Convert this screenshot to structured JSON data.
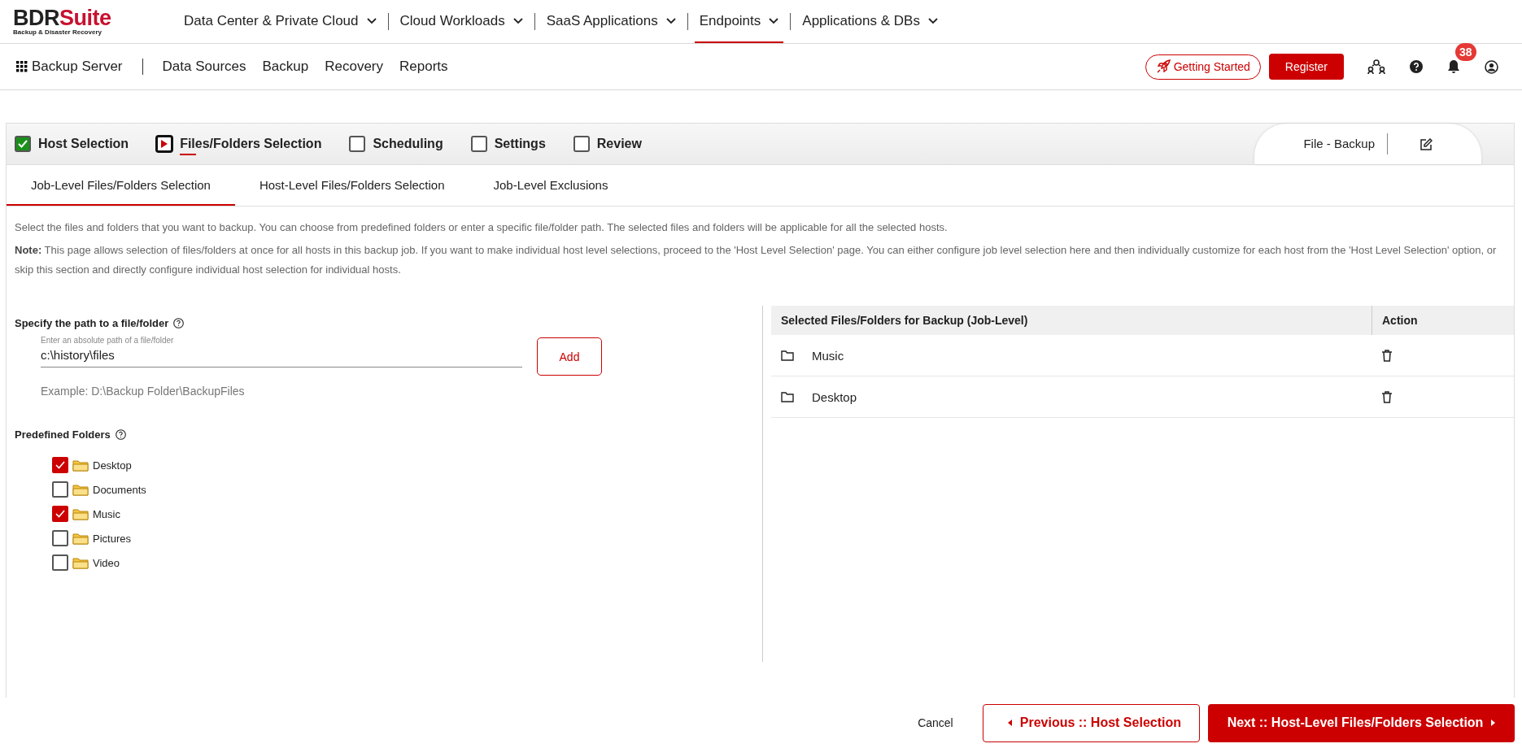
{
  "brand": {
    "prefix": "BDR",
    "suffix": "Suite",
    "tagline": "Backup & Disaster Recovery"
  },
  "top_menu": [
    {
      "label": "Data Center & Private Cloud",
      "selected": false
    },
    {
      "label": "Cloud Workloads",
      "selected": false
    },
    {
      "label": "SaaS Applications",
      "selected": false
    },
    {
      "label": "Endpoints",
      "selected": true
    },
    {
      "label": "Applications & DBs",
      "selected": false
    }
  ],
  "sub_nav": {
    "app_name": "Backup Server",
    "items": [
      "Data Sources",
      "Backup",
      "Recovery",
      "Reports"
    ],
    "getting_started": "Getting Started",
    "register": "Register",
    "notification_count": "38"
  },
  "wizard": {
    "steps": [
      {
        "label": "Host Selection",
        "done": true,
        "selected": false
      },
      {
        "label": "Files/Folders Selection",
        "done": false,
        "selected": true
      },
      {
        "label": "Scheduling",
        "done": false,
        "selected": false
      },
      {
        "label": "Settings",
        "done": false,
        "selected": false
      },
      {
        "label": "Review",
        "done": false,
        "selected": false
      }
    ],
    "job_name": "File - Backup"
  },
  "tabs": [
    {
      "label": "Job-Level Files/Folders Selection",
      "selected": true
    },
    {
      "label": "Host-Level Files/Folders Selection",
      "selected": false
    },
    {
      "label": "Job-Level Exclusions",
      "selected": false
    }
  ],
  "description": "Select the files and folders that you want to backup. You can choose from predefined folders or enter a specific file/folder path. The selected files and folders will be applicable for all the selected hosts.",
  "note": "**Note:** This page allows selection of files/folders at once for all hosts in this backup job. If you want to make individual host level selections, proceed to the 'Host Level Selection' page. You can either configure job level selection here and then individually customize for each host from the 'Host Level Selection' option, or skip this section and directly configure individual host selection for individual hosts.",
  "path_section": {
    "label": "Specify the path to a file/folder",
    "field_label": "Enter an absolute path of a file/folder",
    "value": "c:\\history\\files",
    "example": "Example: D:\\Backup Folder\\BackupFiles",
    "add_button": "Add"
  },
  "predefined": {
    "label": "Predefined Folders",
    "folders": [
      {
        "label": "Desktop",
        "checked": true
      },
      {
        "label": "Documents",
        "checked": false
      },
      {
        "label": "Music",
        "checked": true
      },
      {
        "label": "Pictures",
        "checked": false
      },
      {
        "label": "Video",
        "checked": false
      }
    ]
  },
  "selected_table": {
    "columns": [
      "Selected Files/Folders for Backup (Job-Level)",
      "Action"
    ],
    "rows": [
      {
        "name": "Music"
      },
      {
        "name": "Desktop"
      }
    ]
  },
  "footer": {
    "cancel": "Cancel",
    "previous": "Previous :: Host Selection",
    "next": "Next :: Host-Level Files/Folders Selection"
  }
}
